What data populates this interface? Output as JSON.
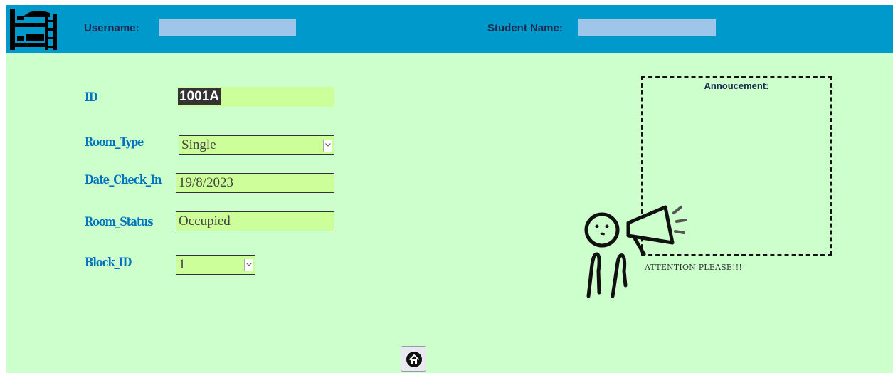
{
  "header": {
    "username_label": "Username:",
    "username_value": "",
    "student_name_label": "Student Name:",
    "student_name_value": "",
    "logo_icon": "bunk-bed-icon"
  },
  "form": {
    "id_label": "ID",
    "id_value": "1001A",
    "room_type_label": "Room_Type",
    "room_type_value": "Single",
    "date_check_in_label": "Date_Check_In",
    "date_check_in_value": "19/8/2023",
    "room_status_label": "Room_Status",
    "room_status_value": "Occupied",
    "block_id_label": "Block_ID",
    "block_id_value": "1"
  },
  "announcement": {
    "title": "Annoucement:",
    "caption": "ATTENTION PLEASE!!!",
    "illustration_icon": "megaphone-person-icon"
  },
  "footer": {
    "home_icon": "home-icon"
  },
  "colors": {
    "header_bg": "#0099cc",
    "page_bg": "#ccffcc",
    "label_color": "#0073bf",
    "field_bg": "#ccff99",
    "header_input_bg": "#9fc5eb"
  }
}
